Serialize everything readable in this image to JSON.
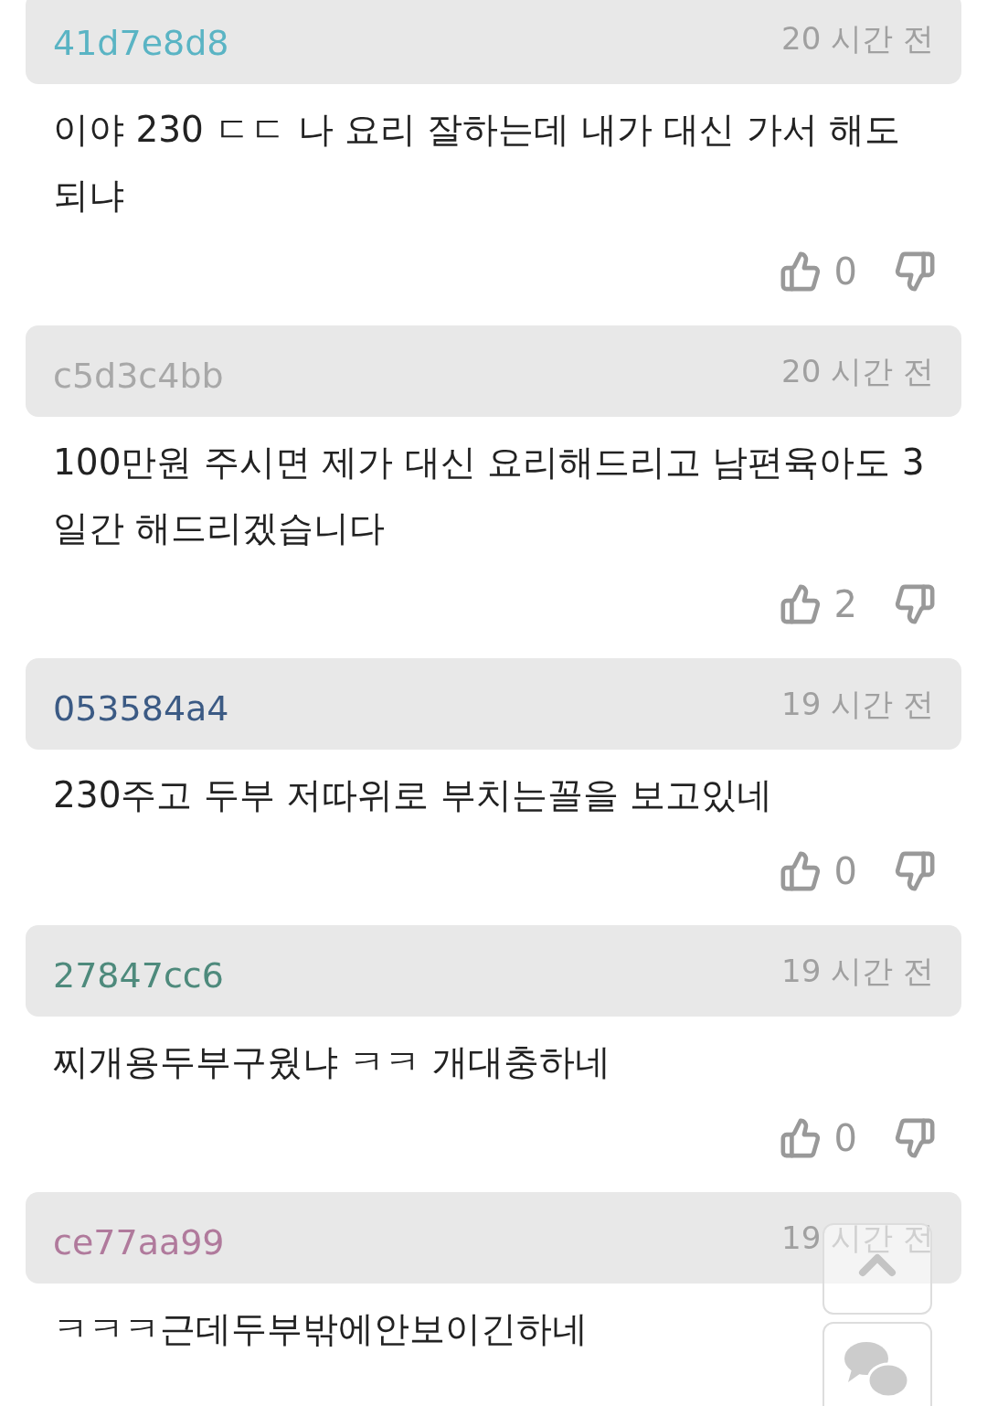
{
  "comments": [
    {
      "author": "41d7e8d8",
      "color": "#5ab4c4",
      "time": "20 시간 전",
      "text": "이야 230 ㄷㄷ 나 요리 잘하는데 내가 대신 가서 해도 되냐",
      "likes": "0"
    },
    {
      "author": "c5d3c4bb",
      "color": "#a8a8a8",
      "time": "20 시간 전",
      "text": "100만원 주시면 제가 대신 요리해드리고 남편육아도 3일간 해드리겠습니다",
      "likes": "2"
    },
    {
      "author": "053584a4",
      "color": "#3b5a84",
      "time": "19 시간 전",
      "text": "230주고 두부 저따위로 부치는꼴을 보고있네",
      "likes": "0"
    },
    {
      "author": "27847cc6",
      "color": "#4e8a7c",
      "time": "19 시간 전",
      "text": "찌개용두부구웠냐 ㅋㅋ 개대충하네",
      "likes": "0"
    },
    {
      "author": "ce77aa99",
      "color": "#b07a9c",
      "time": "19 시간 전",
      "text": "ㅋㅋㅋ근데두부밖에안보이긴하네"
    }
  ]
}
